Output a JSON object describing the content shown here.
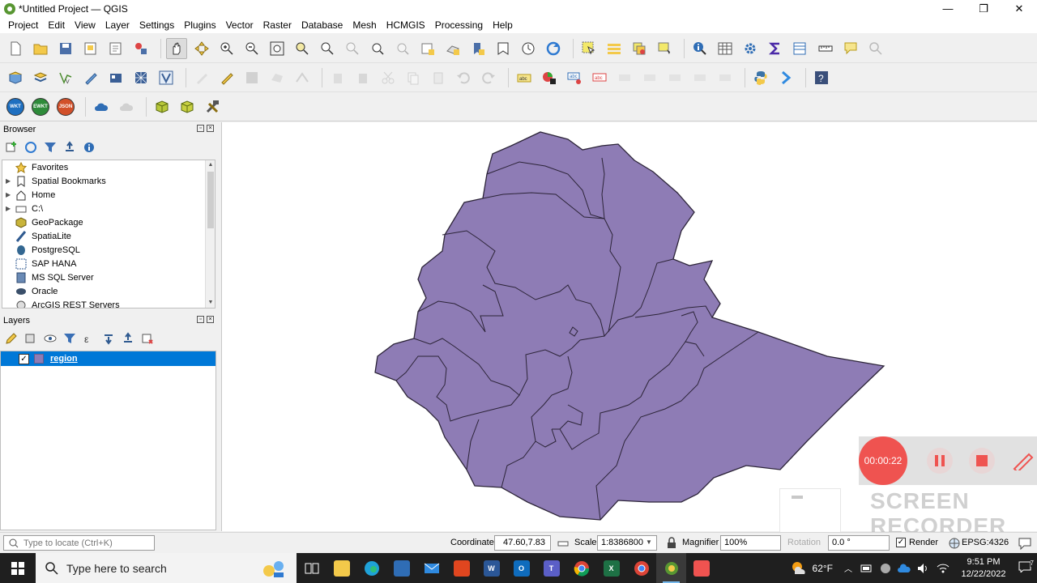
{
  "window": {
    "title": "*Untitled Project — QGIS",
    "controls": [
      "—",
      "❐",
      "✕"
    ]
  },
  "menu": [
    "Project",
    "Edit",
    "View",
    "Layer",
    "Settings",
    "Plugins",
    "Vector",
    "Raster",
    "Database",
    "Mesh",
    "HCMGIS",
    "Processing",
    "Help"
  ],
  "toolbar3": {
    "wkt": "WKT",
    "ewkt": "EWKT",
    "json": "JSON"
  },
  "browser": {
    "title": "Browser",
    "items": [
      {
        "label": "Favorites",
        "icon": "star-icon",
        "expandable": false
      },
      {
        "label": "Spatial Bookmarks",
        "icon": "bookmark-icon",
        "expandable": true
      },
      {
        "label": "Home",
        "icon": "home-folder-icon",
        "expandable": true
      },
      {
        "label": "C:\\",
        "icon": "drive-icon",
        "expandable": true
      },
      {
        "label": "GeoPackage",
        "icon": "geopackage-icon",
        "expandable": false
      },
      {
        "label": "SpatiaLite",
        "icon": "spatialite-icon",
        "expandable": false
      },
      {
        "label": "PostgreSQL",
        "icon": "postgresql-icon",
        "expandable": false
      },
      {
        "label": "SAP HANA",
        "icon": "sap-hana-icon",
        "expandable": false
      },
      {
        "label": "MS SQL Server",
        "icon": "mssql-icon",
        "expandable": false
      },
      {
        "label": "Oracle",
        "icon": "oracle-icon",
        "expandable": false
      },
      {
        "label": "ArcGIS REST Servers",
        "icon": "arcgis-icon",
        "expandable": false
      }
    ]
  },
  "layers": {
    "title": "Layers",
    "items": [
      {
        "label": "region",
        "checked": true,
        "check": "✓",
        "color": "#8e7cb5"
      }
    ]
  },
  "recorder": {
    "time": "00:00:22",
    "watermark_line1": "SCREEN",
    "watermark_line2": "RECORDER"
  },
  "status": {
    "locator_placeholder": "Type to locate (Ctrl+K)",
    "coordinate_label": "Coordinate",
    "coordinate_value": "47.60,7.83",
    "scale_label": "Scale",
    "scale_value": "1:8386800",
    "magnifier_label": "Magnifier",
    "magnifier_value": "100%",
    "rotation_label": "Rotation",
    "rotation_value": "0.0 °",
    "render_label": "Render",
    "render_check": "✓",
    "crs": "EPSG:4326"
  },
  "taskbar": {
    "search_placeholder": "Type here to search",
    "temperature": "62°F",
    "time": "9:51 PM",
    "date": "12/22/2022",
    "notification_count": "7"
  },
  "colors": {
    "region_fill": "#8e7cb5",
    "selection": "#0078d7",
    "recorder": "#ef5350"
  }
}
